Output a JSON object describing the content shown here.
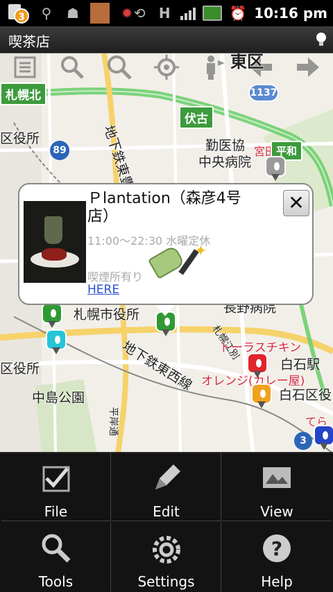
{
  "status_bar": {
    "notification_count": "3",
    "time": "10:16 pm",
    "icons": [
      "notification-icon",
      "usb-icon",
      "android-debug-icon",
      "app-icon",
      "antivirus-icon",
      "screen-rotate-icon",
      "data-h-icon",
      "signal-icon",
      "battery-icon",
      "alarm-icon"
    ]
  },
  "title_bar": {
    "title": "喫茶店"
  },
  "map": {
    "labels": {
      "east_ward": "東区",
      "sapporo_kita": "札幌北",
      "fushiko": "伏古",
      "ward_office_left": "区役所",
      "route89": "89",
      "subway_toho": "地下鉄東豊",
      "route1137": "1137",
      "kin_ikyo": "勤医協",
      "chuo_byoin": "中央病院",
      "miyanomori": "宮田屋",
      "heiwa": "平和",
      "sapporo_shiyakusho": "札幌市役所",
      "nagano_byoin": "長野病院",
      "subway_tozai": "地下鉄東西線",
      "sapporo_bekkan": "札幌江別",
      "zechikin": "トーラスチキン",
      "shiroishi_eki": "白石駅",
      "orenji": "オレンジ(カレー屋)",
      "shiroishi_ku": "白石区役",
      "ward_office_left2": "区役所",
      "nakajima": "中島公園",
      "hiragishi": "平岸通",
      "route3": "3",
      "tera": "てら"
    },
    "toolbar_icons": [
      "list-icon",
      "search-settings-icon",
      "search-icon",
      "locate-icon",
      "street-view-icon",
      "back-arrow-icon",
      "forward-arrow-icon"
    ]
  },
  "popup": {
    "title": "Ｐlantation（森彦4号店）",
    "hours": "11:00〜22:30 水曜定休",
    "smoking": "喫煙所有り",
    "link": "HERE",
    "close": "✕"
  },
  "menu": {
    "items": [
      {
        "label": "File",
        "icon": "checkmark-icon"
      },
      {
        "label": "Edit",
        "icon": "pencil-icon"
      },
      {
        "label": "View",
        "icon": "map-view-icon"
      },
      {
        "label": "Tools",
        "icon": "tools-icon"
      },
      {
        "label": "Settings",
        "icon": "settings-icon"
      },
      {
        "label": "Help",
        "icon": "help-icon"
      }
    ]
  },
  "colors": {
    "green_road": "#5cc45c",
    "marker_green": "#2f9a34",
    "marker_red": "#e1252c",
    "marker_orange": "#f1a21d",
    "marker_cyan": "#26c4d8",
    "marker_gray": "#9a9a9a",
    "link": "#2a4fd6"
  }
}
